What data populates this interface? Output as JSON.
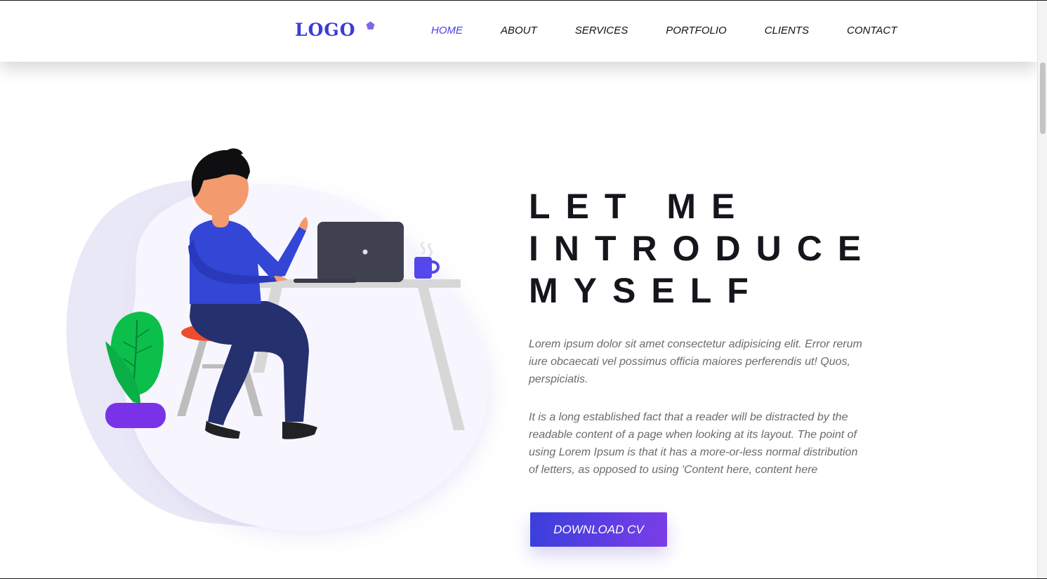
{
  "header": {
    "logo_text": "LOGO",
    "nav": [
      {
        "label": "HOME",
        "active": true
      },
      {
        "label": "ABOUT",
        "active": false
      },
      {
        "label": "SERVICES",
        "active": false
      },
      {
        "label": "PORTFOLIO",
        "active": false
      },
      {
        "label": "CLIENTS",
        "active": false
      },
      {
        "label": "CONTACT",
        "active": false
      }
    ]
  },
  "hero": {
    "title_lines": [
      "LET ME",
      "INTRODUCE",
      "MYSELF"
    ],
    "paragraph_1": "Lorem ipsum dolor sit amet consectetur adipisicing elit. Error rerum iure obcaecati vel possimus officia maiores perferendis ut! Quos, perspiciatis.",
    "paragraph_2": "It is a long established fact that a reader will be distracted by the readable content of a page when looking at its layout. The point of using Lorem Ipsum is that it has a more-or-less normal distribution of letters, as opposed to using 'Content here, content here",
    "button_label": "DOWNLOAD CV"
  },
  "illustration": {
    "subject": "person working at laptop on desk with plant and coffee mug",
    "icons": [
      "laptop-icon",
      "coffee-mug-icon",
      "plant-icon"
    ]
  },
  "colors": {
    "accent": "#4a3fe0",
    "logo": "#3d3bd9",
    "button_gradient_start": "#3b3fdc",
    "button_gradient_end": "#7a3ee8",
    "title": "#15151c",
    "body_text": "#6b6b6b",
    "shirt": "#3346d6",
    "pants": "#25306e",
    "plant": "#0cbf4a",
    "pot": "#7a32e8",
    "stool_seat": "#ee4d2d"
  }
}
